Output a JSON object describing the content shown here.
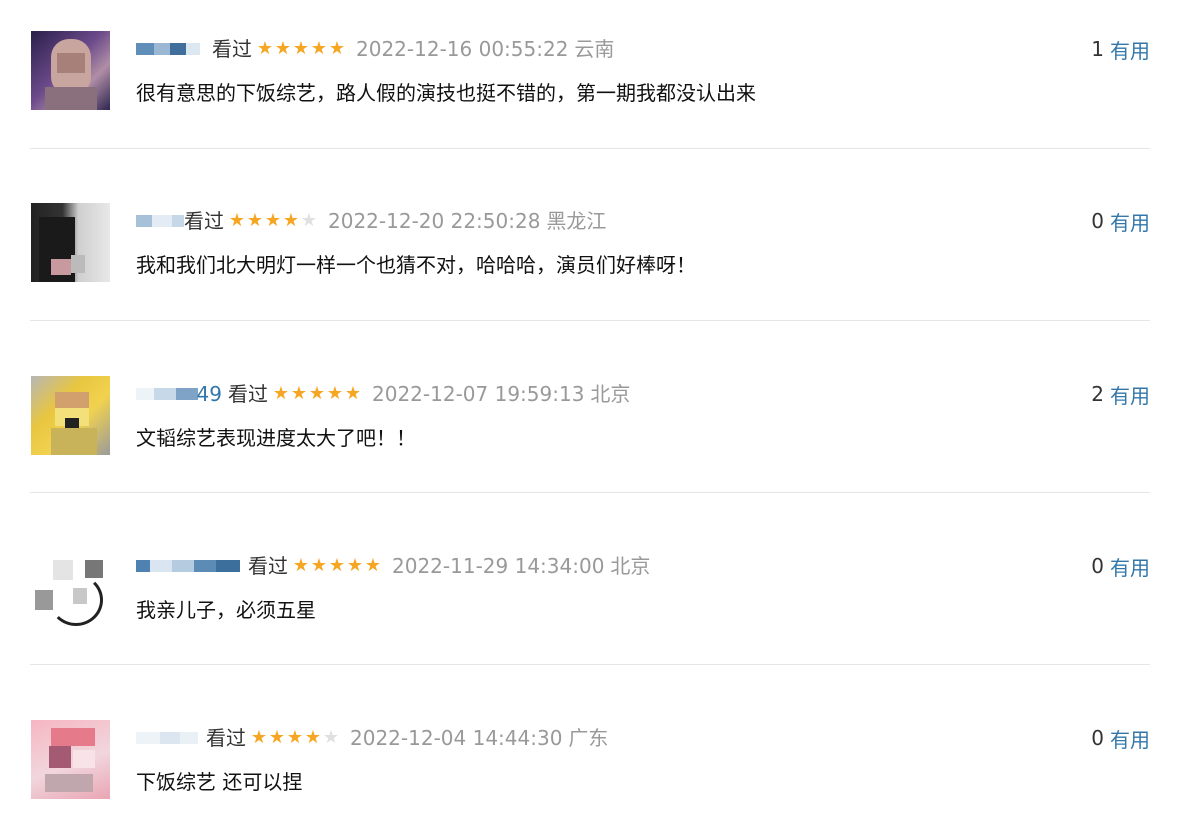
{
  "comments": [
    {
      "user_suffix": "",
      "status": "看过",
      "rating": 5,
      "time": "2022-12-16 00:55:22",
      "location": "云南",
      "content": "很有意思的下饭综艺，路人假的演技也挺不错的，第一期我都没认出来",
      "vote_count": "1",
      "useful_label": "有用"
    },
    {
      "user_suffix": "",
      "status": "看过",
      "rating": 4,
      "time": "2022-12-20 22:50:28",
      "location": "黑龙江",
      "content": "我和我们北大明灯一样一个也猜不对，哈哈哈，演员们好棒呀！",
      "vote_count": "0",
      "useful_label": "有用"
    },
    {
      "user_suffix": "49",
      "status": "看过",
      "rating": 5,
      "time": "2022-12-07 19:59:13",
      "location": "北京",
      "content": "文韬综艺表现进度太大了吧！！",
      "vote_count": "2",
      "useful_label": "有用"
    },
    {
      "user_suffix": "",
      "status": "看过",
      "rating": 5,
      "time": "2022-11-29 14:34:00",
      "location": "北京",
      "content": "我亲儿子，必须五星",
      "vote_count": "0",
      "useful_label": "有用"
    },
    {
      "user_suffix": "",
      "status": "看过",
      "rating": 4,
      "time": "2022-12-04 14:44:30",
      "location": "广东",
      "content": "下饭综艺 还可以捏",
      "vote_count": "0",
      "useful_label": "有用"
    }
  ],
  "icons": {
    "star": "star-icon"
  },
  "colors": {
    "star_on": "#f5a623",
    "star_off": "#e0e0e0",
    "link": "#3377aa",
    "meta_gray": "#999999"
  }
}
